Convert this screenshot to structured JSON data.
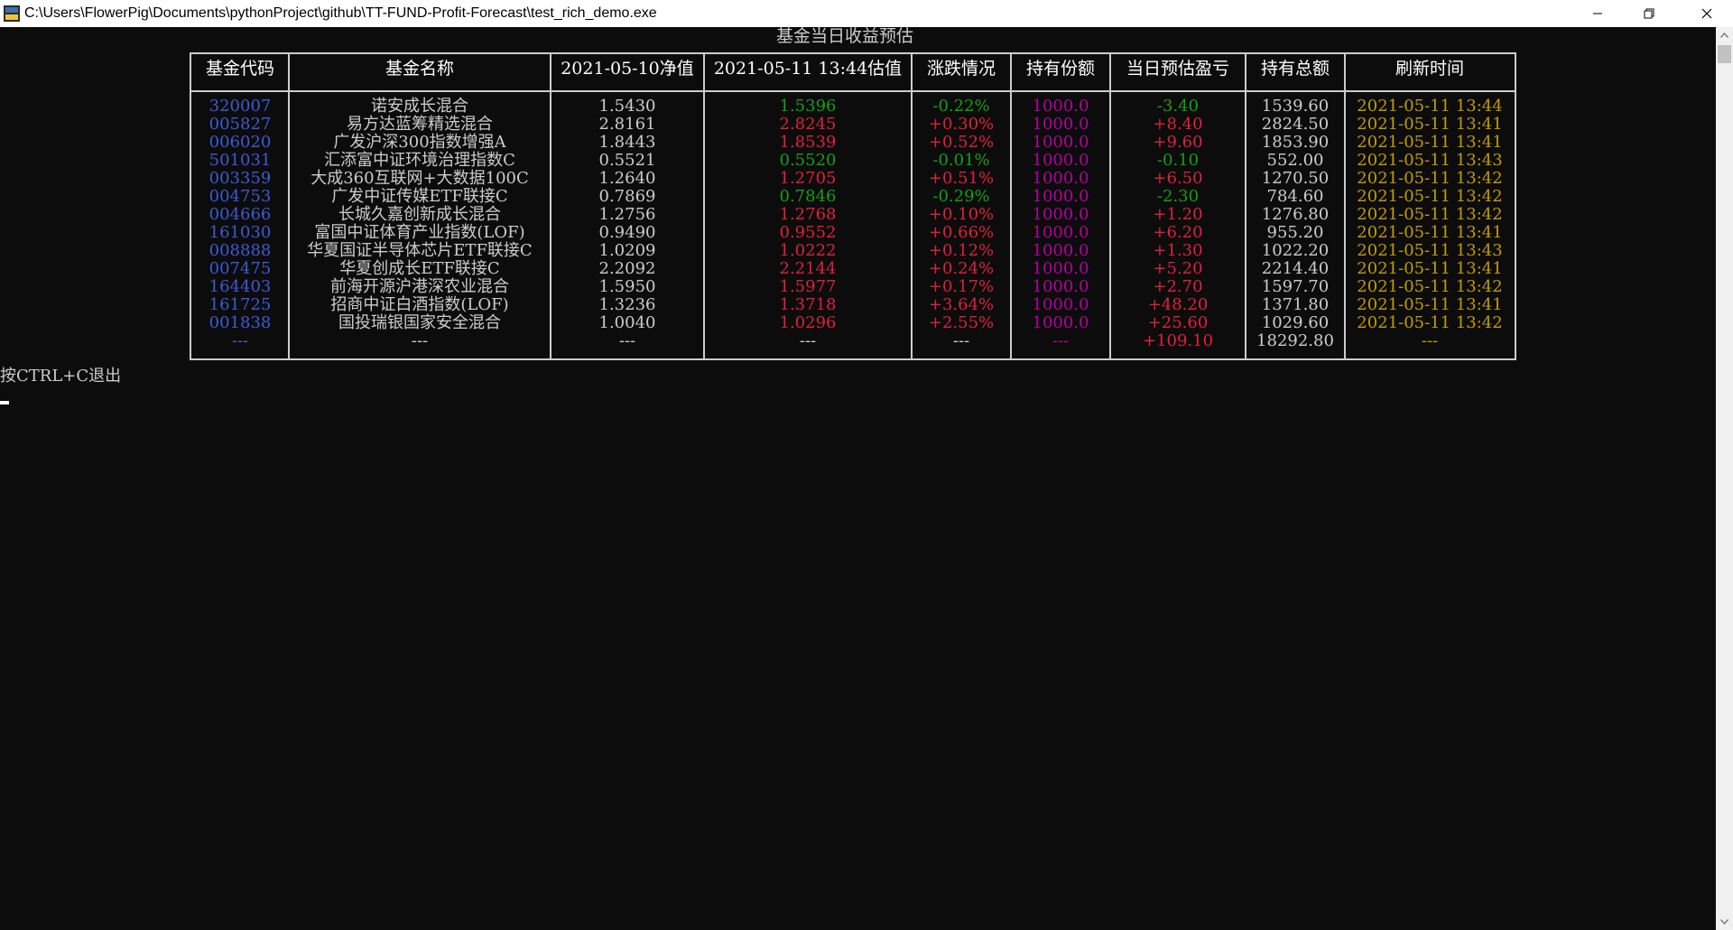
{
  "window": {
    "title": "C:\\Users\\FlowerPig\\Documents\\pythonProject\\github\\TT-FUND-Profit-Forecast\\test_rich_demo.exe",
    "buttons": {
      "minimize": "—",
      "maximize": "❐",
      "close": "✕"
    }
  },
  "table": {
    "title": "基金当日收益预估",
    "headers": [
      "基金代码",
      "基金名称",
      "2021-05-10净值",
      "2021-05-11 13:44估值",
      "涨跌情况",
      "持有份额",
      "当日预估盈亏",
      "持有总额",
      "刷新时间"
    ],
    "rows": [
      {
        "code": "320007",
        "name": "诺安成长混合",
        "nav": "1.5430",
        "est": "1.5396",
        "change": "-0.22%",
        "shares": "1000.0",
        "profit": "-3.40",
        "total": "1539.60",
        "time": "2021-05-11 13:44",
        "color": "#13a10e"
      },
      {
        "code": "005827",
        "name": "易方达蓝筹精选混合",
        "nav": "2.8161",
        "est": "2.8245",
        "change": "+0.30%",
        "shares": "1000.0",
        "profit": "+8.40",
        "total": "2824.50",
        "time": "2021-05-11 13:41",
        "color": "#e0203a"
      },
      {
        "code": "006020",
        "name": "广发沪深300指数增强A",
        "nav": "1.8443",
        "est": "1.8539",
        "change": "+0.52%",
        "shares": "1000.0",
        "profit": "+9.60",
        "total": "1853.90",
        "time": "2021-05-11 13:41",
        "color": "#e0203a"
      },
      {
        "code": "501031",
        "name": "汇添富中证环境治理指数C",
        "nav": "0.5521",
        "est": "0.5520",
        "change": "-0.01%",
        "shares": "1000.0",
        "profit": "-0.10",
        "total": "552.00",
        "time": "2021-05-11 13:43",
        "color": "#13a10e"
      },
      {
        "code": "003359",
        "name": "大成360互联网+大数据100C",
        "nav": "1.2640",
        "est": "1.2705",
        "change": "+0.51%",
        "shares": "1000.0",
        "profit": "+6.50",
        "total": "1270.50",
        "time": "2021-05-11 13:42",
        "color": "#e0203a"
      },
      {
        "code": "004753",
        "name": "广发中证传媒ETF联接C",
        "nav": "0.7869",
        "est": "0.7846",
        "change": "-0.29%",
        "shares": "1000.0",
        "profit": "-2.30",
        "total": "784.60",
        "time": "2021-05-11 13:42",
        "color": "#13a10e"
      },
      {
        "code": "004666",
        "name": "长城久嘉创新成长混合",
        "nav": "1.2756",
        "est": "1.2768",
        "change": "+0.10%",
        "shares": "1000.0",
        "profit": "+1.20",
        "total": "1276.80",
        "time": "2021-05-11 13:42",
        "color": "#e0203a"
      },
      {
        "code": "161030",
        "name": "富国中证体育产业指数(LOF)",
        "nav": "0.9490",
        "est": "0.9552",
        "change": "+0.66%",
        "shares": "1000.0",
        "profit": "+6.20",
        "total": "955.20",
        "time": "2021-05-11 13:41",
        "color": "#e0203a"
      },
      {
        "code": "008888",
        "name": "华夏国证半导体芯片ETF联接C",
        "nav": "1.0209",
        "est": "1.0222",
        "change": "+0.12%",
        "shares": "1000.0",
        "profit": "+1.30",
        "total": "1022.20",
        "time": "2021-05-11 13:43",
        "color": "#e0203a"
      },
      {
        "code": "007475",
        "name": "华夏创成长ETF联接C",
        "nav": "2.2092",
        "est": "2.2144",
        "change": "+0.24%",
        "shares": "1000.0",
        "profit": "+5.20",
        "total": "2214.40",
        "time": "2021-05-11 13:41",
        "color": "#e0203a"
      },
      {
        "code": "164403",
        "name": "前海开源沪港深农业混合",
        "nav": "1.5950",
        "est": "1.5977",
        "change": "+0.17%",
        "shares": "1000.0",
        "profit": "+2.70",
        "total": "1597.70",
        "time": "2021-05-11 13:42",
        "color": "#e0203a"
      },
      {
        "code": "161725",
        "name": "招商中证白酒指数(LOF)",
        "nav": "1.3236",
        "est": "1.3718",
        "change": "+3.64%",
        "shares": "1000.0",
        "profit": "+48.20",
        "total": "1371.80",
        "time": "2021-05-11 13:41",
        "color": "#e0203a"
      },
      {
        "code": "001838",
        "name": "国投瑞银国家安全混合",
        "nav": "1.0040",
        "est": "1.0296",
        "change": "+2.55%",
        "shares": "1000.0",
        "profit": "+25.60",
        "total": "1029.60",
        "time": "2021-05-11 13:42",
        "color": "#e0203a"
      }
    ],
    "summary": {
      "code": "---",
      "name": "---",
      "nav": "---",
      "est": "---",
      "change": "---",
      "shares": "---",
      "profit": "+109.10",
      "total": "18292.80",
      "time": "---",
      "color": "#e0203a"
    }
  },
  "console": {
    "quit_hint": "按CTRL+C退出"
  },
  "colors": {
    "background": "#0c0c0c",
    "code": "#3b5bd6",
    "up": "#e0203a",
    "down": "#13a10e",
    "shares": "#b4009e",
    "time": "#c19c00"
  }
}
